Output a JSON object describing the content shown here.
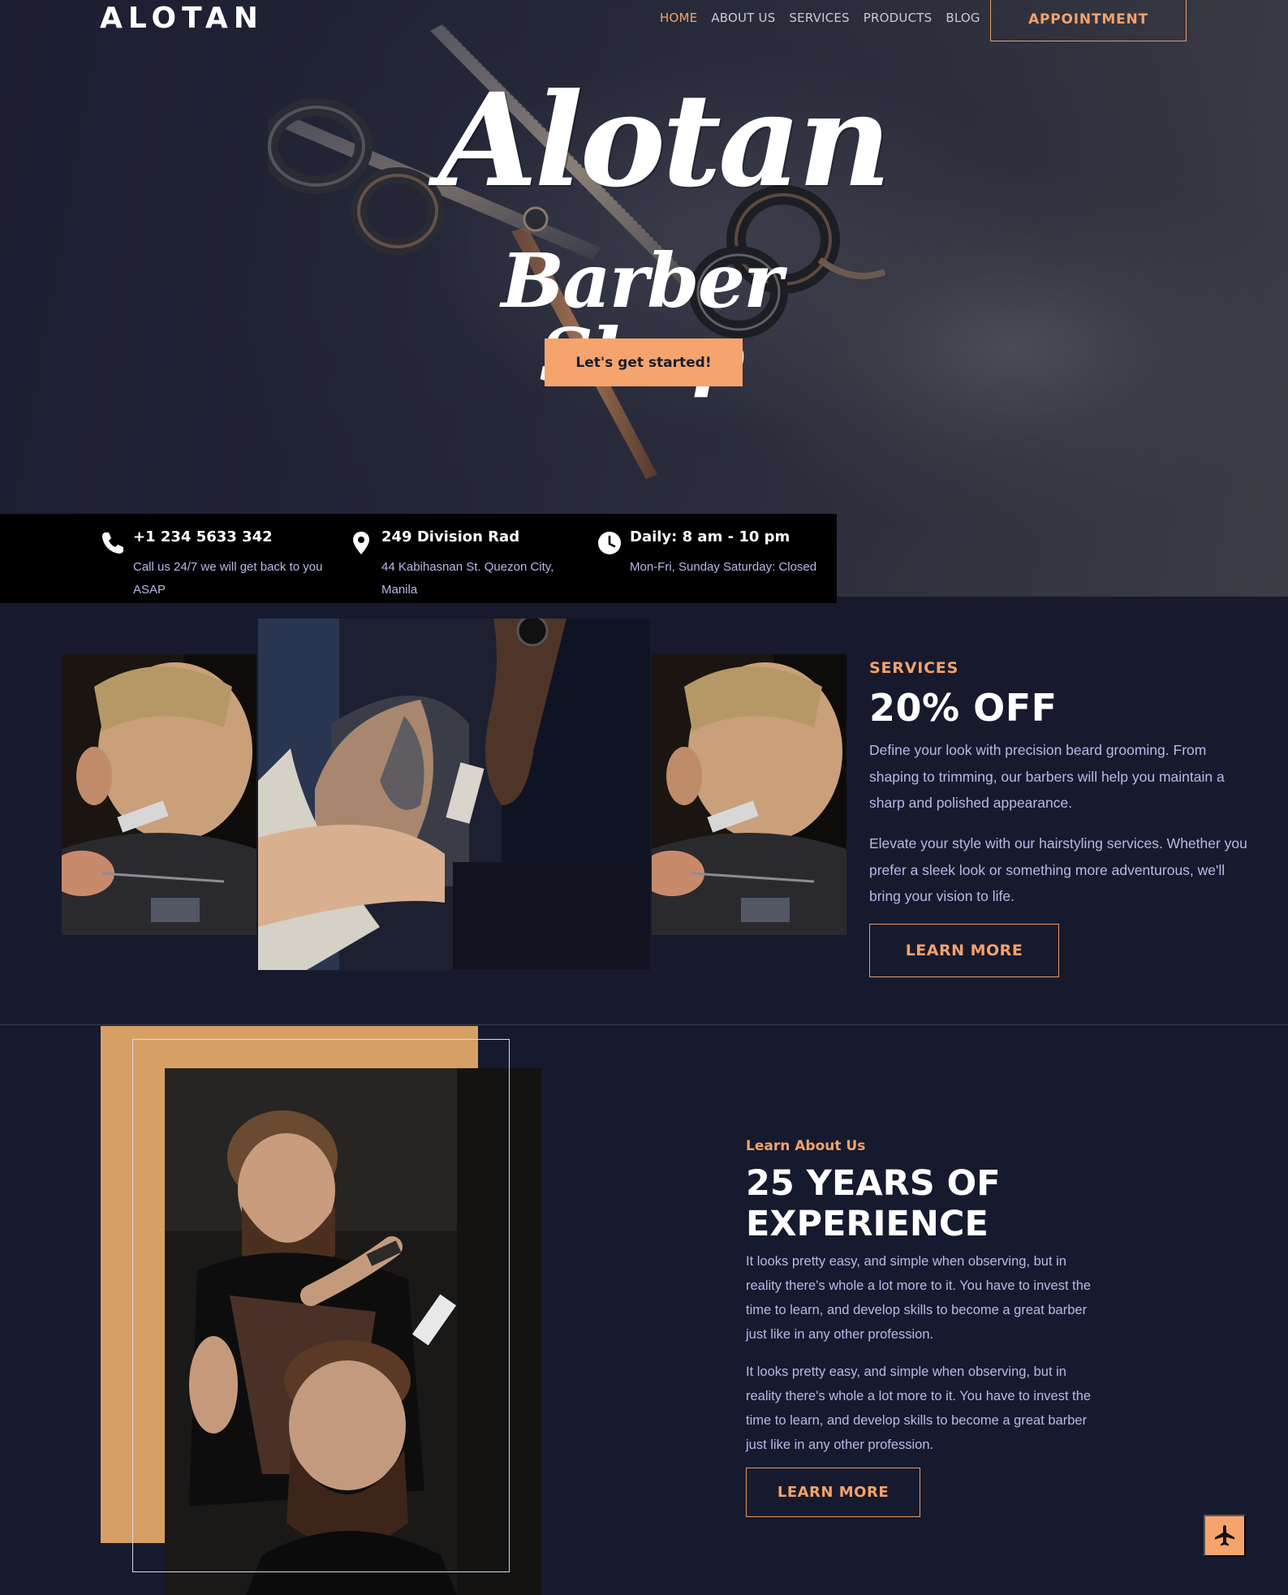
{
  "header": {
    "brand": "ALOTAN",
    "nav": [
      "HOME",
      "ABOUT US",
      "SERVICES",
      "PRODUCTS",
      "BLOG"
    ],
    "active_nav": "HOME",
    "appointment_label": "APPOINTMENT"
  },
  "hero": {
    "title": "Alotan",
    "subtitle": "Barber Shop",
    "cta_label": "Let's get started!"
  },
  "contact": [
    {
      "icon": "phone-icon",
      "title": "+1 234 5633 342",
      "text": "Call us 24/7 we will get back to you ASAP"
    },
    {
      "icon": "location-pin-icon",
      "title": "249 Division Rad",
      "text": "44 Kabihasnan St. Quezon City, Manila"
    },
    {
      "icon": "clock-icon",
      "title": "Daily: 8 am - 10 pm",
      "text": "Mon-Fri, Sunday Saturday: Closed"
    }
  ],
  "services": {
    "label": "SERVICES",
    "heading": "20% OFF",
    "paragraphs": [
      "Define your look with precision beard grooming. From shaping to trimming, our barbers will help you maintain a sharp and polished appearance.",
      "Elevate your style with our hairstyling services. Whether you prefer a sleek look or something more adventurous, we'll bring your vision to life."
    ],
    "button_label": "LEARN MORE"
  },
  "about": {
    "label": "Learn About Us",
    "heading": "25 YEARS OF EXPERIENCE",
    "paragraphs": [
      "It looks pretty easy, and simple when observing, but in reality there's whole a lot more to it. You have to invest the time to learn, and develop skills to become a great barber just like in any other profession.",
      "It looks pretty easy, and simple when observing, but in reality there's whole a lot more to it. You have to invest the time to learn, and develop skills to become a great barber just like in any other profession."
    ],
    "button_label": "LEARN MORE"
  },
  "floating_button_icon": "airplane-icon",
  "colors": {
    "accent": "#f6a46e",
    "background": "#161a2e",
    "body_text": "#b7b9e6",
    "gold_block": "#d6a065"
  }
}
